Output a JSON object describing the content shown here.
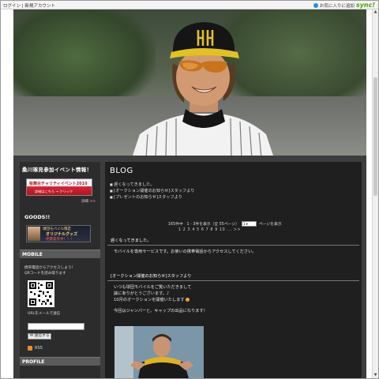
{
  "topbar": {
    "login": "ログイン",
    "separator": "|",
    "register": "新規アカウント",
    "favorite_label": "お気に入りに追加",
    "brand": "sync!"
  },
  "sidebar": {
    "event_header": "桑川琢見参加イベント情報！",
    "event_banner_title": "桧舞台チャリティイベント2010",
    "event_banner_sub": "詳細はこちら → クリック",
    "more_link": "詳細 >>",
    "goods_header": "GOODS!!",
    "goods_banner_line1": "球団モバイル限定",
    "goods_banner_line2": "オリジナルグッズ",
    "goods_banner_line3": "絶賛発売中！！！",
    "mobile_header": "MOBILE",
    "mobile_text_1": "携帯電話からアクセスしよう！",
    "mobile_text_2": "QRコードを読み取ります",
    "url_label": "URLをメールで送信",
    "mail_value": "",
    "send_button": "送信する",
    "rss_label": "RSS",
    "profile_header": "PROFILE"
  },
  "main": {
    "blog_title": "BLOG",
    "recent_posts": [
      "遅くなってきました。",
      "[オークション開催のお知らせ]スタッフより",
      "[プレゼントのお知らせ]スタッフより"
    ],
    "pager_summary": "165件中　1 - 3件を表示（全 55ページ）",
    "page_select_value": "1",
    "pager_suffix": "ページを表示",
    "page_numbers": "1 2 3 4 5 6 7 8 9 10 ... >>",
    "posts": [
      {
        "title": "遅くなってきました。",
        "body": "モバイルを専用サービスです。お使いの携帯電話からアクセスしてください。"
      },
      {
        "title": "[オークション開催のお知らせ]スタッフより",
        "line1": "いつも球団モバイルをご覧いただきまして",
        "line2": "誠にありがとうございます。♪",
        "line3": "10月のオークションを開催いたします",
        "line4": "今回はジャンパーと、キャップの出品になります！"
      }
    ]
  }
}
